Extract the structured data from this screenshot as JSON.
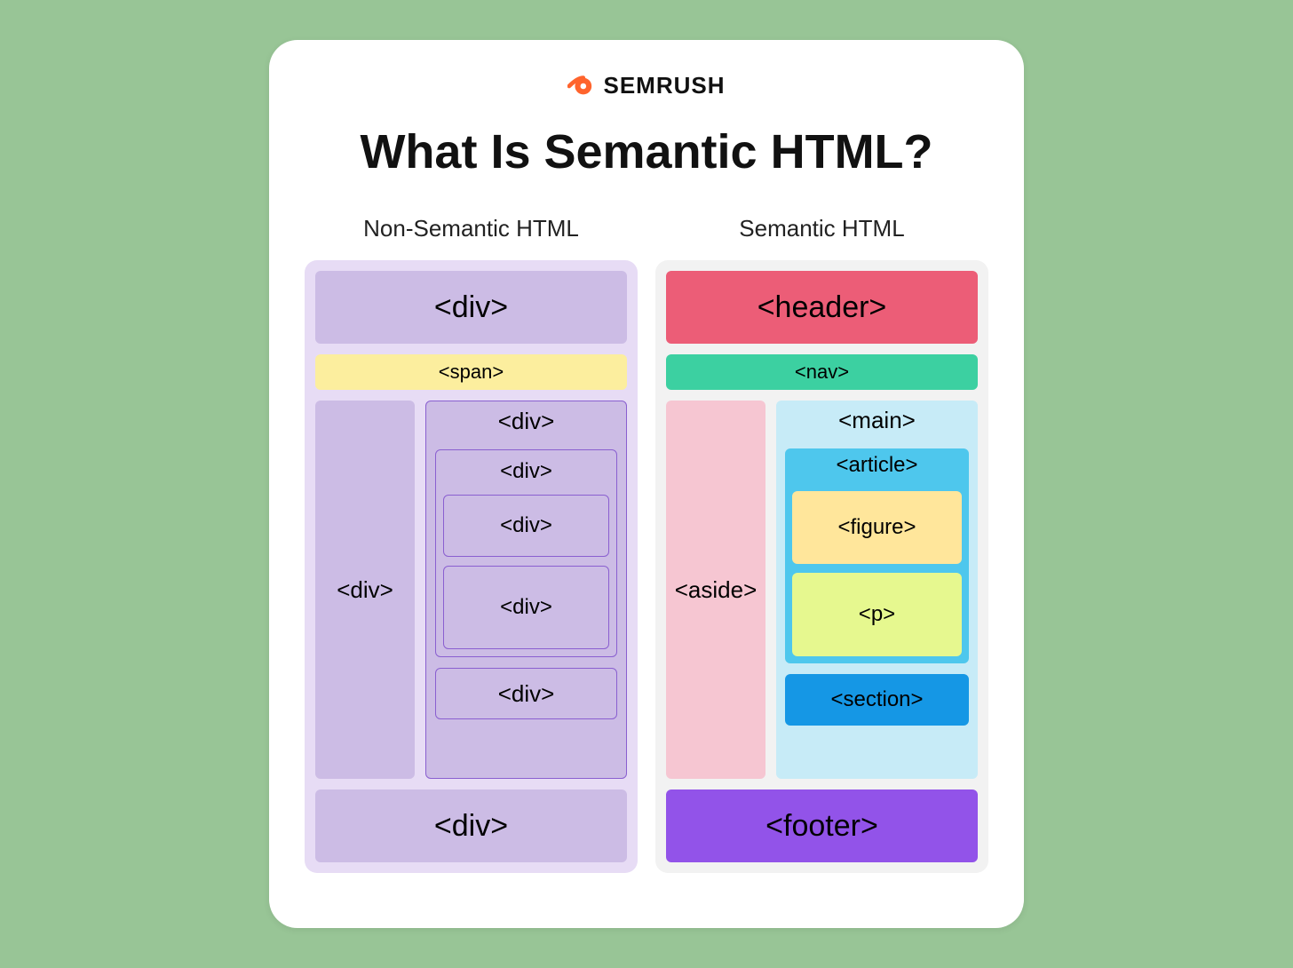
{
  "brand": {
    "name": "SEMRUSH"
  },
  "title": "What Is Semantic HTML?",
  "columns": {
    "left": {
      "title": "Non-Semantic HTML",
      "header": "<div>",
      "nav": "<span>",
      "aside": "<div>",
      "main": "<div>",
      "article": "<div>",
      "figure": "<div>",
      "p": "<div>",
      "section": "<div>",
      "footer": "<div>"
    },
    "right": {
      "title": "Semantic HTML",
      "header": "<header>",
      "nav": "<nav>",
      "aside": "<aside>",
      "main": "<main>",
      "article": "<article>",
      "figure": "<figure>",
      "p": "<p>",
      "section": "<section>",
      "footer": "<footer>"
    }
  }
}
